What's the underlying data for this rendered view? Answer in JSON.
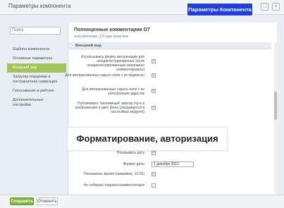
{
  "window": {
    "title": "Параметры компонента"
  },
  "badge": "Параметры Компонента",
  "sidebar": {
    "search_placeholder": "Поиск",
    "items": [
      {
        "label": "Шаблон компонента"
      },
      {
        "label": "Основные параметры"
      },
      {
        "label": "Внешний вид"
      },
      {
        "label": "Загрузка порциями и постраничная навигация"
      },
      {
        "label": "Голосование и рейтинг"
      },
      {
        "label": "Дополнительные настройки"
      }
    ]
  },
  "component": {
    "title": "Полноценные комментарии D7",
    "subtitle": "realcommenter_2.0 tape show.tree"
  },
  "section": {
    "label": "Внешний вид"
  },
  "rows": [
    {
      "label": "Использовать форму авторизации для незарегистрированных (если незарегистрированным запрещено комментировать)",
      "type": "checkbox",
      "checked": true
    },
    {
      "label": "Для авторизованных скрыть поле с их подписью",
      "type": "checkbox",
      "checked": true
    },
    {
      "label": "Для авторизованных скрыть поле с их электронным адресом",
      "type": "checkbox",
      "checked": true
    },
    {
      "label": "Публиковать \"анонимный\" аватар (путь к изображению и цвет фона (указываются в настройках модуля))",
      "type": "checkbox",
      "checked": true
    },
    {
      "label": "Показывать дату",
      "type": "checkbox",
      "checked": true
    },
    {
      "label": "Формат даты",
      "type": "select",
      "value": "1 декабря 2012"
    },
    {
      "label": "Показывать время (например, 13:20)",
      "type": "checkbox",
      "checked": true
    },
    {
      "label": "Не собирать подписи комментаторов",
      "type": "checkbox",
      "checked": false
    }
  ],
  "overlay": {
    "text": "Форматирование, авторизация"
  },
  "footer": {
    "save_label": "Сохранить",
    "cancel_label": "Отменить"
  },
  "colors": {
    "accent": "#a5c35b",
    "save": "#7fb341",
    "badge": "#1f3ee6"
  }
}
